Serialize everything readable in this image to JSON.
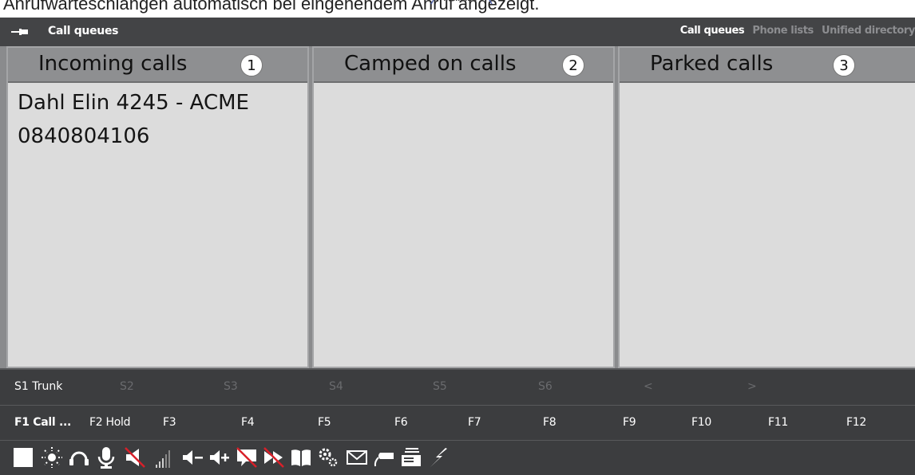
{
  "caption": "Anrufwarteschlangen automatisch bei eingehendem Anruf angezeigt.",
  "header": {
    "title": "Call queues",
    "nav": [
      "Call queues",
      "Phone lists",
      "Unified directory"
    ],
    "active_nav": "Call queues"
  },
  "panels": [
    {
      "title": "Incoming calls",
      "badge": "1",
      "calls": [
        "Dahl Elin 4245 - ACME",
        "0840804106"
      ]
    },
    {
      "title": "Camped on calls",
      "badge": "2",
      "calls": []
    },
    {
      "title": "Parked calls",
      "badge": "3",
      "calls": []
    }
  ],
  "s_keys": [
    {
      "label": "S1 Trunk",
      "active": true
    },
    {
      "label": "S2",
      "active": false
    },
    {
      "label": "S3",
      "active": false
    },
    {
      "label": "S4",
      "active": false
    },
    {
      "label": "S5",
      "active": false
    },
    {
      "label": "S6",
      "active": false
    },
    {
      "label": "<",
      "active": false
    },
    {
      "label": ">",
      "active": false
    }
  ],
  "f_keys": [
    "F1 Call ...",
    "F2 Hold",
    "F3",
    "F4",
    "F5",
    "F6",
    "F7",
    "F8",
    "F9",
    "F10",
    "F11",
    "F12"
  ],
  "toolbar_icons": [
    "white-square-icon",
    "brightness-icon",
    "headset-icon",
    "microphone-icon",
    "speaker-muted-icon",
    "signal-bars-icon",
    "volume-down-icon",
    "volume-up-icon",
    "message-blocked-icon",
    "forward-blocked-icon",
    "book-icon",
    "gears-icon",
    "mail-icon",
    "handset-icon",
    "fax-icon",
    "lightning-icon"
  ],
  "colors": {
    "app_bg": "#444547",
    "panel_bg": "#dcdcdc",
    "panel_header": "#8e8f91",
    "text_active": "#ffffff",
    "text_dim": "#6a6b6e"
  }
}
